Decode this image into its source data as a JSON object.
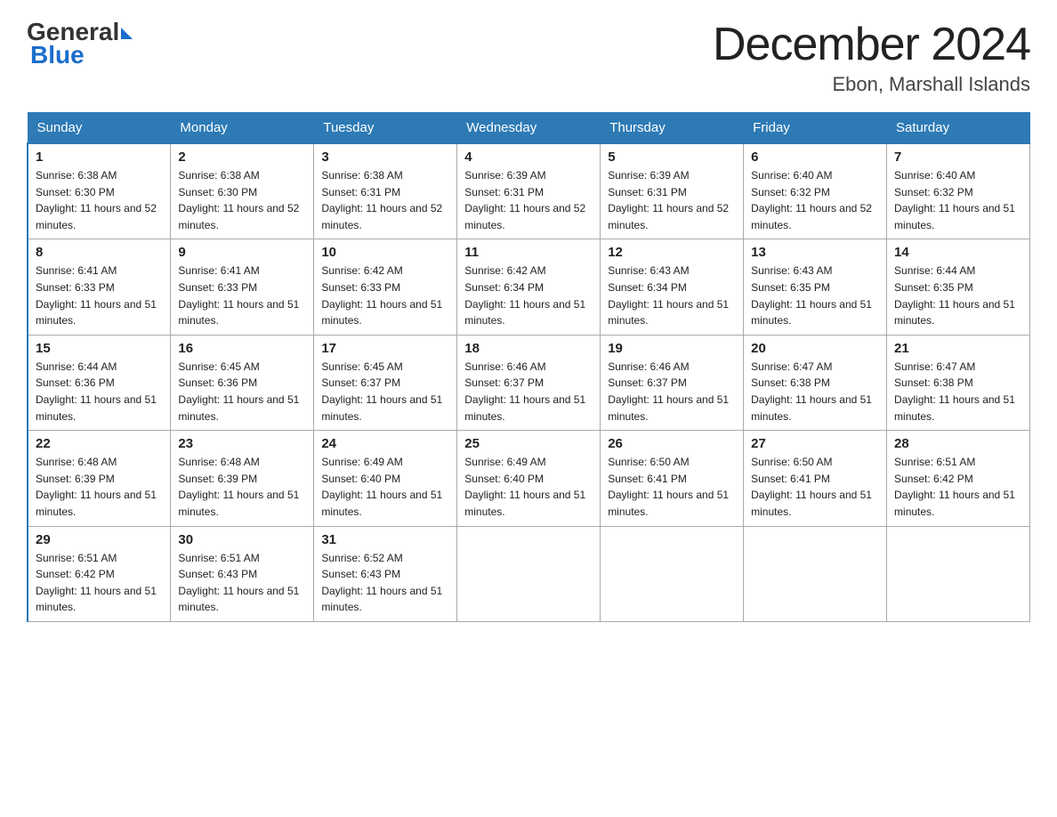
{
  "header": {
    "logo": {
      "general": "General",
      "blue": "Blue"
    },
    "title": "December 2024",
    "location": "Ebon, Marshall Islands"
  },
  "days_of_week": [
    "Sunday",
    "Monday",
    "Tuesday",
    "Wednesday",
    "Thursday",
    "Friday",
    "Saturday"
  ],
  "weeks": [
    [
      {
        "day": "1",
        "sunrise": "6:38 AM",
        "sunset": "6:30 PM",
        "daylight": "11 hours and 52 minutes."
      },
      {
        "day": "2",
        "sunrise": "6:38 AM",
        "sunset": "6:30 PM",
        "daylight": "11 hours and 52 minutes."
      },
      {
        "day": "3",
        "sunrise": "6:38 AM",
        "sunset": "6:31 PM",
        "daylight": "11 hours and 52 minutes."
      },
      {
        "day": "4",
        "sunrise": "6:39 AM",
        "sunset": "6:31 PM",
        "daylight": "11 hours and 52 minutes."
      },
      {
        "day": "5",
        "sunrise": "6:39 AM",
        "sunset": "6:31 PM",
        "daylight": "11 hours and 52 minutes."
      },
      {
        "day": "6",
        "sunrise": "6:40 AM",
        "sunset": "6:32 PM",
        "daylight": "11 hours and 52 minutes."
      },
      {
        "day": "7",
        "sunrise": "6:40 AM",
        "sunset": "6:32 PM",
        "daylight": "11 hours and 51 minutes."
      }
    ],
    [
      {
        "day": "8",
        "sunrise": "6:41 AM",
        "sunset": "6:33 PM",
        "daylight": "11 hours and 51 minutes."
      },
      {
        "day": "9",
        "sunrise": "6:41 AM",
        "sunset": "6:33 PM",
        "daylight": "11 hours and 51 minutes."
      },
      {
        "day": "10",
        "sunrise": "6:42 AM",
        "sunset": "6:33 PM",
        "daylight": "11 hours and 51 minutes."
      },
      {
        "day": "11",
        "sunrise": "6:42 AM",
        "sunset": "6:34 PM",
        "daylight": "11 hours and 51 minutes."
      },
      {
        "day": "12",
        "sunrise": "6:43 AM",
        "sunset": "6:34 PM",
        "daylight": "11 hours and 51 minutes."
      },
      {
        "day": "13",
        "sunrise": "6:43 AM",
        "sunset": "6:35 PM",
        "daylight": "11 hours and 51 minutes."
      },
      {
        "day": "14",
        "sunrise": "6:44 AM",
        "sunset": "6:35 PM",
        "daylight": "11 hours and 51 minutes."
      }
    ],
    [
      {
        "day": "15",
        "sunrise": "6:44 AM",
        "sunset": "6:36 PM",
        "daylight": "11 hours and 51 minutes."
      },
      {
        "day": "16",
        "sunrise": "6:45 AM",
        "sunset": "6:36 PM",
        "daylight": "11 hours and 51 minutes."
      },
      {
        "day": "17",
        "sunrise": "6:45 AM",
        "sunset": "6:37 PM",
        "daylight": "11 hours and 51 minutes."
      },
      {
        "day": "18",
        "sunrise": "6:46 AM",
        "sunset": "6:37 PM",
        "daylight": "11 hours and 51 minutes."
      },
      {
        "day": "19",
        "sunrise": "6:46 AM",
        "sunset": "6:37 PM",
        "daylight": "11 hours and 51 minutes."
      },
      {
        "day": "20",
        "sunrise": "6:47 AM",
        "sunset": "6:38 PM",
        "daylight": "11 hours and 51 minutes."
      },
      {
        "day": "21",
        "sunrise": "6:47 AM",
        "sunset": "6:38 PM",
        "daylight": "11 hours and 51 minutes."
      }
    ],
    [
      {
        "day": "22",
        "sunrise": "6:48 AM",
        "sunset": "6:39 PM",
        "daylight": "11 hours and 51 minutes."
      },
      {
        "day": "23",
        "sunrise": "6:48 AM",
        "sunset": "6:39 PM",
        "daylight": "11 hours and 51 minutes."
      },
      {
        "day": "24",
        "sunrise": "6:49 AM",
        "sunset": "6:40 PM",
        "daylight": "11 hours and 51 minutes."
      },
      {
        "day": "25",
        "sunrise": "6:49 AM",
        "sunset": "6:40 PM",
        "daylight": "11 hours and 51 minutes."
      },
      {
        "day": "26",
        "sunrise": "6:50 AM",
        "sunset": "6:41 PM",
        "daylight": "11 hours and 51 minutes."
      },
      {
        "day": "27",
        "sunrise": "6:50 AM",
        "sunset": "6:41 PM",
        "daylight": "11 hours and 51 minutes."
      },
      {
        "day": "28",
        "sunrise": "6:51 AM",
        "sunset": "6:42 PM",
        "daylight": "11 hours and 51 minutes."
      }
    ],
    [
      {
        "day": "29",
        "sunrise": "6:51 AM",
        "sunset": "6:42 PM",
        "daylight": "11 hours and 51 minutes."
      },
      {
        "day": "30",
        "sunrise": "6:51 AM",
        "sunset": "6:43 PM",
        "daylight": "11 hours and 51 minutes."
      },
      {
        "day": "31",
        "sunrise": "6:52 AM",
        "sunset": "6:43 PM",
        "daylight": "11 hours and 51 minutes."
      },
      null,
      null,
      null,
      null
    ]
  ],
  "colors": {
    "header_bg": "#2d7ab5",
    "header_text": "#ffffff",
    "border": "#aaaaaa",
    "row_border": "#2d7ab5"
  }
}
